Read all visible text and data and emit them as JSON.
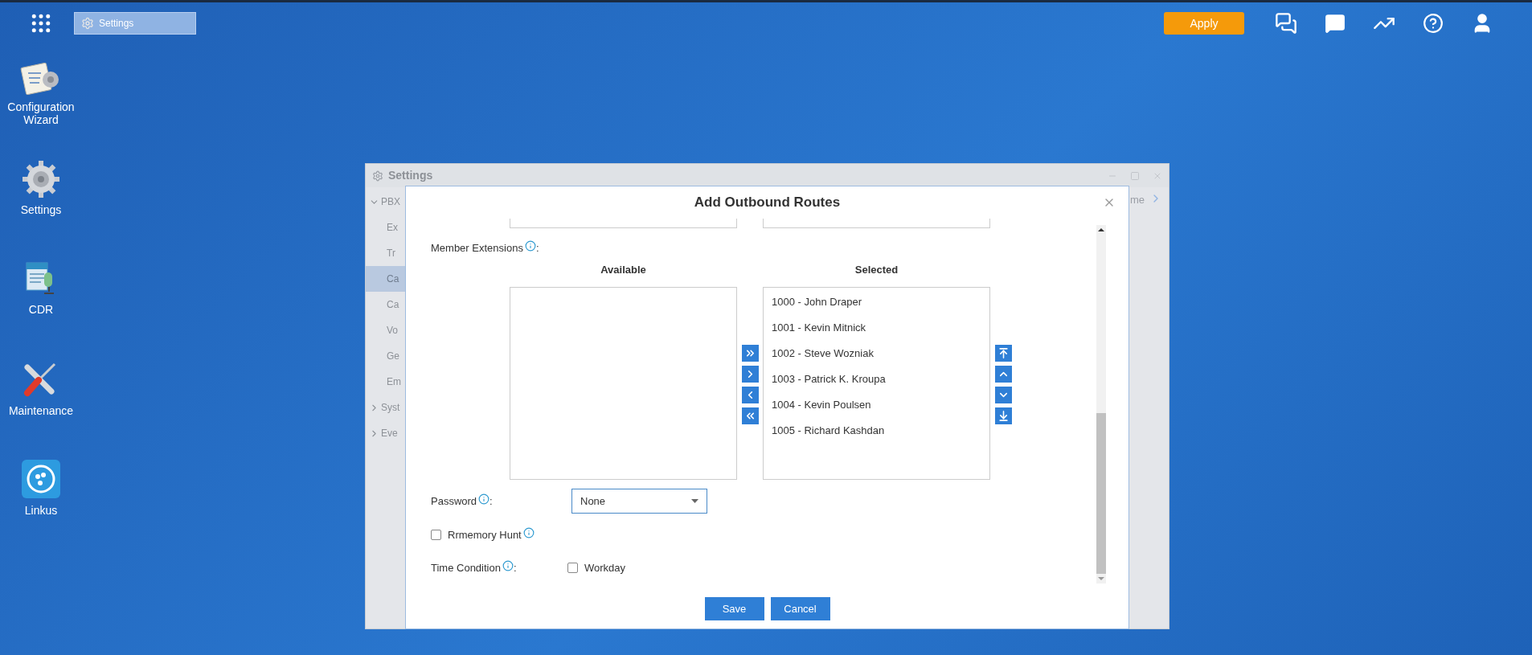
{
  "taskbar": {
    "window_button": "Settings",
    "apply": "Apply"
  },
  "desktop_icons": [
    {
      "label": "Configuration Wizard",
      "kind": "wizard"
    },
    {
      "label": "Settings",
      "kind": "gear"
    },
    {
      "label": "CDR",
      "kind": "cdr"
    },
    {
      "label": "Maintenance",
      "kind": "tools"
    },
    {
      "label": "Linkus",
      "kind": "linkus"
    }
  ],
  "background_window": {
    "title": "Settings",
    "tab_fragment": "me",
    "sidebar": [
      {
        "label": "PBX",
        "expanded": true,
        "children": [
          {
            "label": "Ex",
            "selected": false
          },
          {
            "label": "Tr",
            "selected": false
          },
          {
            "label": "Ca",
            "selected": true
          },
          {
            "label": "Ca",
            "selected": false
          },
          {
            "label": "Vo",
            "selected": false
          },
          {
            "label": "Ge",
            "selected": false
          },
          {
            "label": "Em",
            "selected": false
          }
        ]
      },
      {
        "label": "Syst",
        "expanded": false
      },
      {
        "label": "Eve",
        "expanded": false
      }
    ]
  },
  "dialog": {
    "title": "Add Outbound Routes",
    "member_extensions": {
      "label": "Member Extensions",
      "colon": ":",
      "available_title": "Available",
      "selected_title": "Selected",
      "selected": [
        "1000 - John Draper",
        "1001 - Kevin Mitnick",
        "1002 - Steve Wozniak",
        "1003 - Patrick K. Kroupa",
        "1004 - Kevin Poulsen",
        "1005 - Richard Kashdan"
      ],
      "transfer_buttons": [
        {
          "kind": "all_right"
        },
        {
          "kind": "right"
        },
        {
          "kind": "left"
        },
        {
          "kind": "all_left"
        }
      ],
      "order_buttons": [
        {
          "kind": "top"
        },
        {
          "kind": "up"
        },
        {
          "kind": "down"
        },
        {
          "kind": "bottom"
        }
      ]
    },
    "password": {
      "label": "Password",
      "colon": ":",
      "value": "None"
    },
    "rrmemory_hunt": {
      "label": "Rrmemory Hunt",
      "checked": false
    },
    "time_condition": {
      "label": "Time Condition",
      "colon": ":",
      "options": [
        {
          "label": "Workday",
          "checked": false
        }
      ]
    },
    "buttons": [
      "Save",
      "Cancel"
    ]
  }
}
